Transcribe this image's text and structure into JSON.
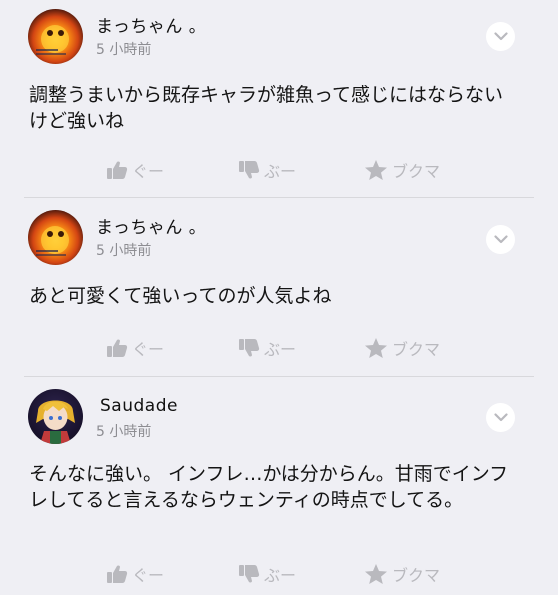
{
  "comments": [
    {
      "username": "まっちゃん 。",
      "timestamp": "5 小時前",
      "text": "調整うまいから既存キャラが雑魚って感じにはならないけど強いね",
      "avatar": "fire-avatar",
      "actions": {
        "good": "ぐー",
        "bad": "ぶー",
        "bookmark": "ブクマ"
      }
    },
    {
      "username": "まっちゃん 。",
      "timestamp": "5 小時前",
      "text": "あと可愛くて強いってのが人気よね",
      "avatar": "fire-avatar",
      "actions": {
        "good": "ぐー",
        "bad": "ぶー",
        "bookmark": "ブクマ"
      }
    },
    {
      "username": "Saudade",
      "timestamp": "5 小時前",
      "text": "そんなに強い。 インフレ…かは分からん。甘雨でインフレしてると言えるならウェンティの時点でしてる。",
      "avatar": "character-avatar",
      "actions": {
        "good": "ぐー",
        "bad": "ぶー",
        "bookmark": "ブクマ"
      }
    }
  ],
  "colors": {
    "background": "#efeff4",
    "action_gray": "#b9b9be",
    "timestamp_gray": "#8d8d92"
  }
}
